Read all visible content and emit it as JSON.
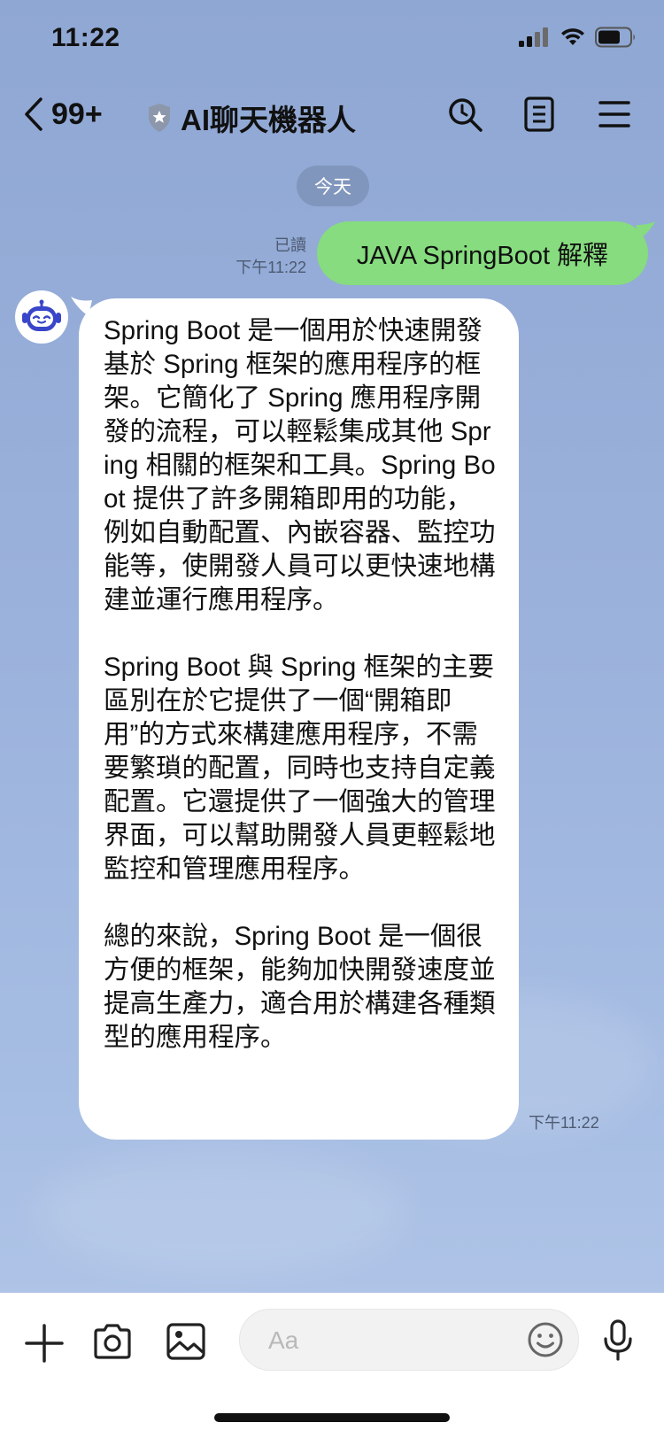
{
  "status_bar": {
    "time": "11:22"
  },
  "header": {
    "back_count": "99+",
    "title": "AI聊天機器人"
  },
  "date_divider": "今天",
  "messages": {
    "outgoing": {
      "read_label": "已讀",
      "time": "下午11:22",
      "text": "JAVA SpringBoot 解釋"
    },
    "incoming": {
      "text": "Spring Boot 是一個用於快速開發基於 Spring 框架的應用程序的框架。它簡化了 Spring 應用程序開發的流程，可以輕鬆集成其他 Spring 相關的框架和工具。Spring Boot 提供了許多開箱即用的功能，例如自動配置、內嵌容器、監控功能等，使開發人員可以更快速地構建並運行應用程序。\n\nSpring Boot 與 Spring 框架的主要區別在於它提供了一個“開箱即用”的方式來構建應用程序，不需要繁瑣的配置，同時也支持自定義配置。它還提供了一個強大的管理界面，可以幫助開發人員更輕鬆地監控和管理應用程序。\n\n總的來說，Spring Boot 是一個很方便的框架，能夠加快開發速度並提高生產力，適合用於構建各種類型的應用程序。",
      "time": "下午11:22"
    }
  },
  "input": {
    "placeholder": "Aa"
  },
  "colors": {
    "outgoing_bubble": "#86dc7e",
    "incoming_bubble": "#ffffff",
    "background": "#9bb2dc"
  },
  "icons": [
    "signal-icon",
    "wifi-icon",
    "battery-icon",
    "back-chevron-icon",
    "verified-shield-icon",
    "search-icon",
    "notes-icon",
    "menu-icon",
    "bot-avatar-icon",
    "plus-icon",
    "camera-icon",
    "image-icon",
    "emoji-icon",
    "microphone-icon"
  ]
}
